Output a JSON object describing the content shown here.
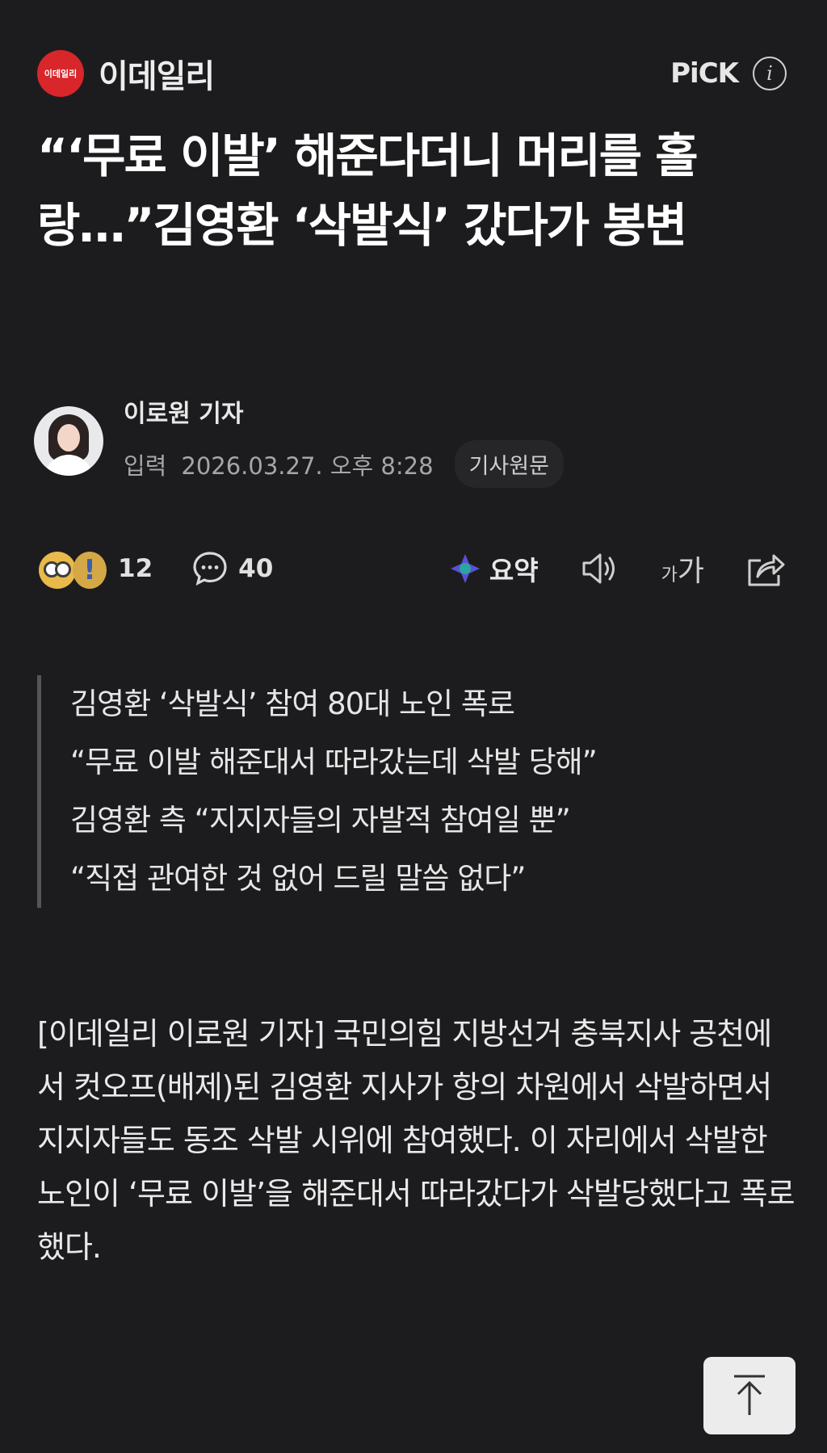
{
  "press": {
    "logo_text": "이데일리",
    "name": "이데일리",
    "pick_label": "PiCK",
    "info_glyph": "i"
  },
  "headline": "“‘무료 이발’ 해준다더니 머리를 홀랑…”김영환 ‘삭발식’ 갔다가 봉변",
  "byline": {
    "reporter": "이로원 기자",
    "input_label": "입력",
    "datetime": "2026.03.27. 오후 8:28",
    "original_button": "기사원문"
  },
  "toolbar": {
    "reaction_count": "12",
    "comment_count": "40",
    "summary_label": "요약",
    "font_small": "가",
    "font_large": "가"
  },
  "summary_lines": [
    "김영환 ‘삭발식’ 참여 80대 노인 폭로",
    "“무료 이발 해준대서 따라갔는데 삭발 당해”",
    "김영환 측 “지지자들의 자발적 참여일 뿐”",
    "“직접 관여한 것 없어 드릴 말씀 없다”"
  ],
  "body": "[이데일리 이로원 기자] 국민의힘 지방선거 충북지사 공천에서 컷오프(배제)된 김영환 지사가 항의 차원에서 삭발하면서 지지자들도 동조 삭발 시위에 참여했다. 이 자리에서 삭발한 노인이 ‘무료 이발’을 해준대서 따라갔다가 삭발당했다고 폭로했다.",
  "colors": {
    "background": "#1c1c1e",
    "logo_red": "#d8262b",
    "text": "#f2f2f2",
    "muted": "#a6a6a6"
  },
  "icons": [
    "info-icon",
    "reaction-emoji-icon",
    "comment-icon",
    "ai-summary-icon",
    "speaker-icon",
    "font-size-icon",
    "share-icon",
    "arrow-up-icon"
  ]
}
